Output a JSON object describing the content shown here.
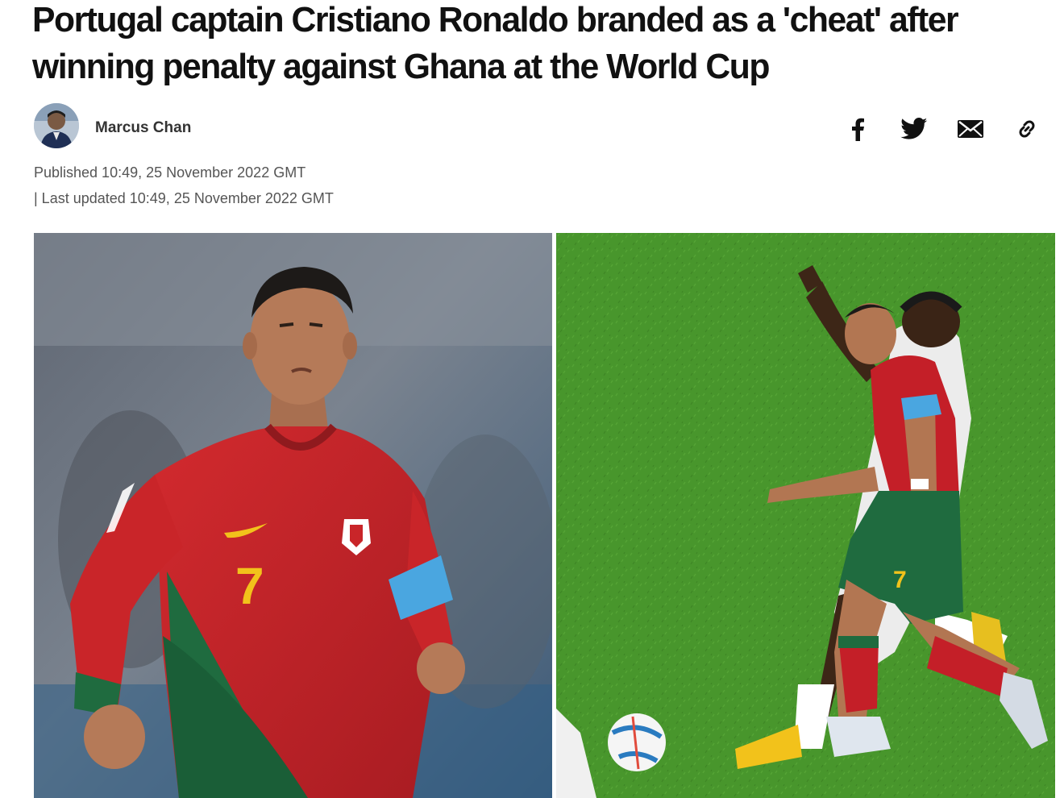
{
  "article": {
    "headline": "Portugal captain Cristiano Ronaldo branded as a 'cheat' after winning penalty against Ghana at the World Cup"
  },
  "author": {
    "name": "Marcus Chan"
  },
  "meta": {
    "published": "Published 10:49, 25 November 2022 GMT",
    "updated": "| Last updated 10:49, 25 November 2022 GMT"
  },
  "share": {
    "icons": [
      "facebook-icon",
      "twitter-icon",
      "email-icon",
      "link-icon"
    ]
  },
  "photos": {
    "left_jersey_number": "7",
    "right_jersey_number": "7"
  },
  "colors": {
    "jersey_red": "#c41f28",
    "jersey_green": "#1f6b3f",
    "pitch_green": "#4b9a2e",
    "armband_blue": "#4aa6e0"
  }
}
